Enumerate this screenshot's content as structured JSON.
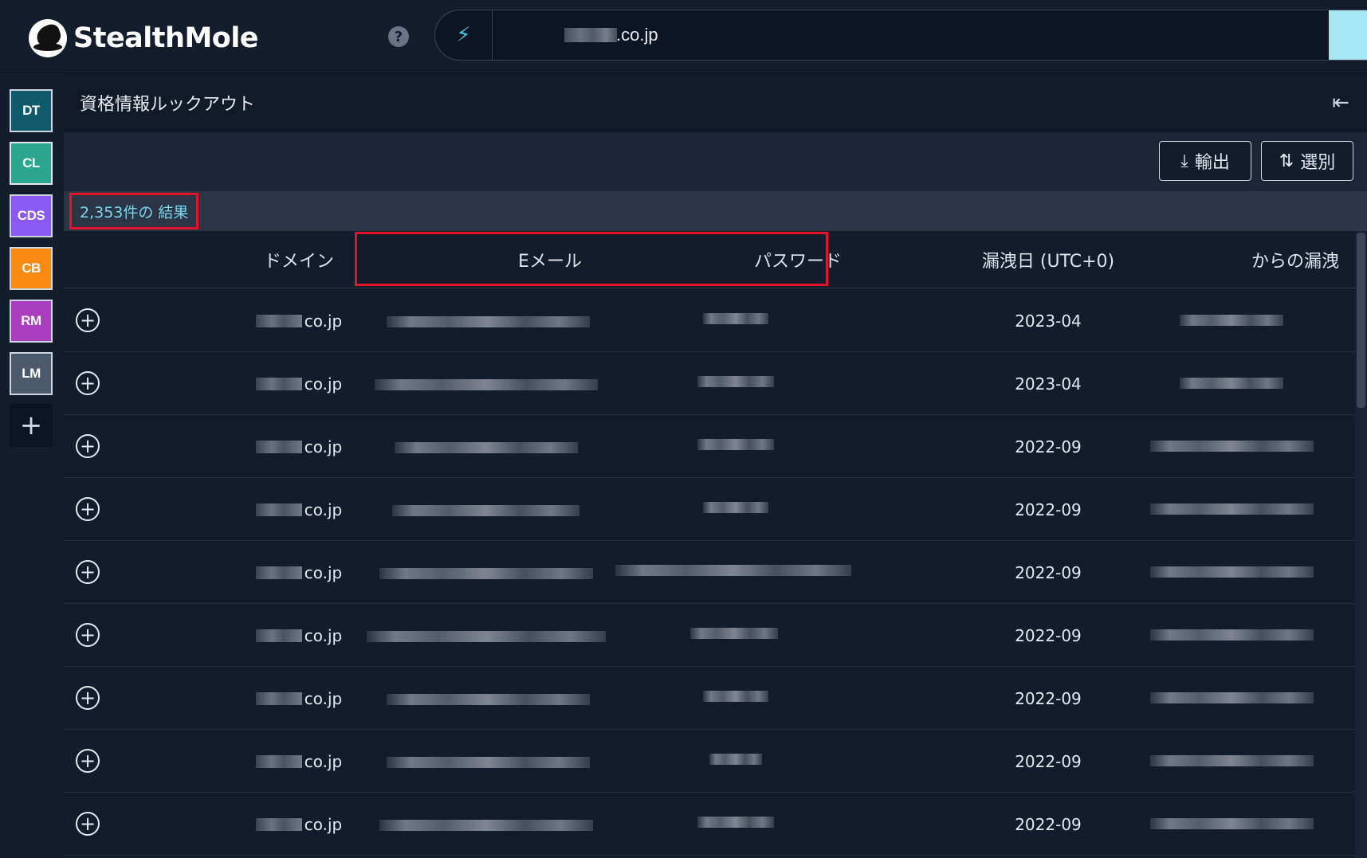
{
  "app": {
    "name": "StealthMole"
  },
  "search": {
    "value": ".co.jp"
  },
  "rail": {
    "items": [
      {
        "label": "DT",
        "color": "#0e5a6a",
        "key": "dt"
      },
      {
        "label": "CL",
        "color": "#2aa58e",
        "key": "cl"
      },
      {
        "label": "CDS",
        "color": "#8b57f5",
        "key": "cds"
      },
      {
        "label": "CB",
        "color": "#f78b12",
        "key": "cb"
      },
      {
        "label": "RM",
        "color": "#a93dbd",
        "key": "rm"
      },
      {
        "label": "LM",
        "color": "#4c5a6b",
        "key": "lm"
      }
    ],
    "add_label": "+"
  },
  "panel": {
    "title": "資格情報ルックアウト",
    "export_label": "輸出",
    "sort_label": "選別",
    "results_count": "2,353件の 結果"
  },
  "table": {
    "headers": {
      "domain": "ドメイン",
      "email": "Eメール",
      "password": "パスワード",
      "leak_date": "漏洩日 (UTC+0)",
      "source": "からの漏洩"
    },
    "rows": [
      {
        "domain": "co.jp",
        "date": "2023-04"
      },
      {
        "domain": "co.jp",
        "date": "2023-04"
      },
      {
        "domain": "co.jp",
        "date": "2022-09"
      },
      {
        "domain": "co.jp",
        "date": "2022-09"
      },
      {
        "domain": "co.jp",
        "date": "2022-09"
      },
      {
        "domain": "co.jp",
        "date": "2022-09"
      },
      {
        "domain": "co.jp",
        "date": "2022-09"
      },
      {
        "domain": "co.jp",
        "date": "2022-09"
      },
      {
        "domain": "co.jp",
        "date": "2022-09"
      }
    ]
  },
  "icons": {
    "help": "?",
    "search_mode": "⚡",
    "collapse": "⇤",
    "export": "⤓",
    "sort": "⇅",
    "expand_row": "+"
  },
  "colors": {
    "accent": "#79d6ec",
    "highlight_border": "#e3142b"
  }
}
